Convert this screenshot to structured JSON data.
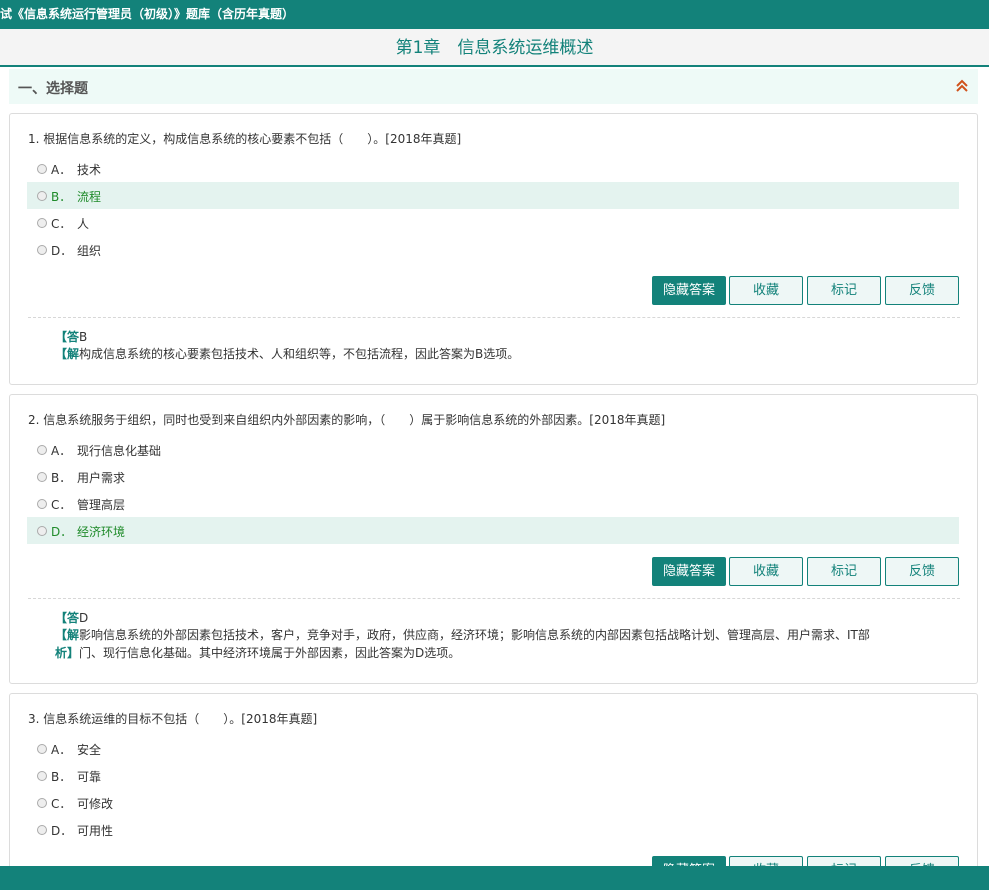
{
  "header": {
    "book_title": "试《信息系统运行管理员（初级）》题库（含历年真题）",
    "chapter_title": "第1章　信息系统运维概述"
  },
  "section": {
    "title": "一、选择题"
  },
  "buttons": {
    "hide_answer": "隐藏答案",
    "favorite": "收藏",
    "mark": "标记",
    "feedback": "反馈"
  },
  "answer_labels": {
    "answer_prefix": "【答",
    "analysis_prefix": "【解",
    "analysis_close": "析】"
  },
  "questions": [
    {
      "text": "1. 根据信息系统的定义，构成信息系统的核心要素不包括（　　）。[2018年真题]",
      "options": [
        {
          "letter": "A．",
          "text": "技术"
        },
        {
          "letter": "B．",
          "text": "流程"
        },
        {
          "letter": "C．",
          "text": "人"
        },
        {
          "letter": "D．",
          "text": "组织"
        }
      ],
      "correct_index": 1,
      "answer": "B",
      "analysis": "构成信息系统的核心要素包括技术、人和组织等，不包括流程，因此答案为B选项。"
    },
    {
      "text": "2. 信息系统服务于组织，同时也受到来自组织内外部因素的影响，（　　）属于影响信息系统的外部因素。[2018年真题]",
      "options": [
        {
          "letter": "A．",
          "text": "现行信息化基础"
        },
        {
          "letter": "B．",
          "text": "用户需求"
        },
        {
          "letter": "C．",
          "text": "管理高层"
        },
        {
          "letter": "D．",
          "text": "经济环境"
        }
      ],
      "correct_index": 3,
      "answer": "D",
      "analysis_line1": "影响信息系统的外部因素包括技术，客户，竞争对手，政府，供应商，经济环境；影响信息系统的内部因素包括战略计划、管理高层、用户需求、IT部",
      "analysis_line2": "门、现行信息化基础。其中经济环境属于外部因素，因此答案为D选项。"
    },
    {
      "text": "3. 信息系统运维的目标不包括（　　）。[2018年真题]",
      "options": [
        {
          "letter": "A．",
          "text": "安全"
        },
        {
          "letter": "B．",
          "text": "可靠"
        },
        {
          "letter": "C．",
          "text": "可修改"
        },
        {
          "letter": "D．",
          "text": "可用性"
        }
      ]
    }
  ],
  "colors": {
    "brand": "#13827a",
    "correct_bg": "#e4f3ef",
    "correct_text": "#1f8b2a",
    "section_bg": "#eefaf7"
  },
  "icons": {
    "collapse": "double-chevron-up-icon"
  }
}
